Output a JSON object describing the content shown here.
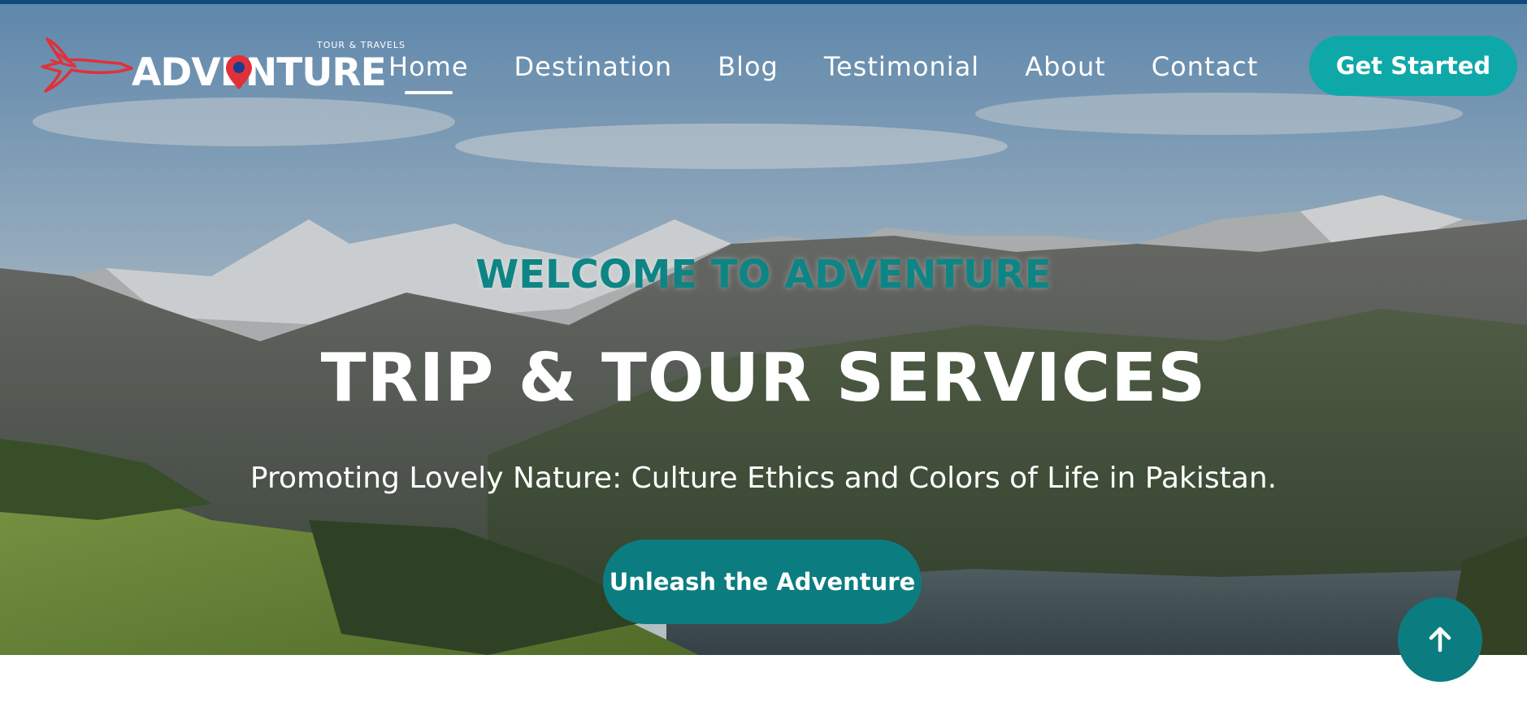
{
  "logo": {
    "tagline": "TOUR  & TRAVELS",
    "wordmark": "ADVENTURE",
    "bird_icon": "eagle-icon",
    "pin_icon": "location-pin-icon"
  },
  "nav": {
    "items": [
      {
        "label": "Home",
        "active": true
      },
      {
        "label": "Destination",
        "active": false
      },
      {
        "label": "Blog",
        "active": false
      },
      {
        "label": "Testimonial",
        "active": false
      },
      {
        "label": "About",
        "active": false
      },
      {
        "label": "Contact",
        "active": false
      }
    ],
    "cta_label": "Get Started"
  },
  "hero": {
    "kicker": "WELCOME TO ADVENTURE",
    "title": "TRIP & TOUR SERVICES",
    "subtitle": "Promoting Lovely Nature: Culture Ethics and Colors of Life in Pakistan.",
    "button_label": "Unleash the Adventure"
  },
  "scroll_top": {
    "icon": "arrow-up-icon"
  },
  "colors": {
    "accent": "#0fa8a9",
    "accent_dark": "#0b7d80",
    "topbar": "#0e4a7e",
    "logo_red": "#e0313a"
  }
}
